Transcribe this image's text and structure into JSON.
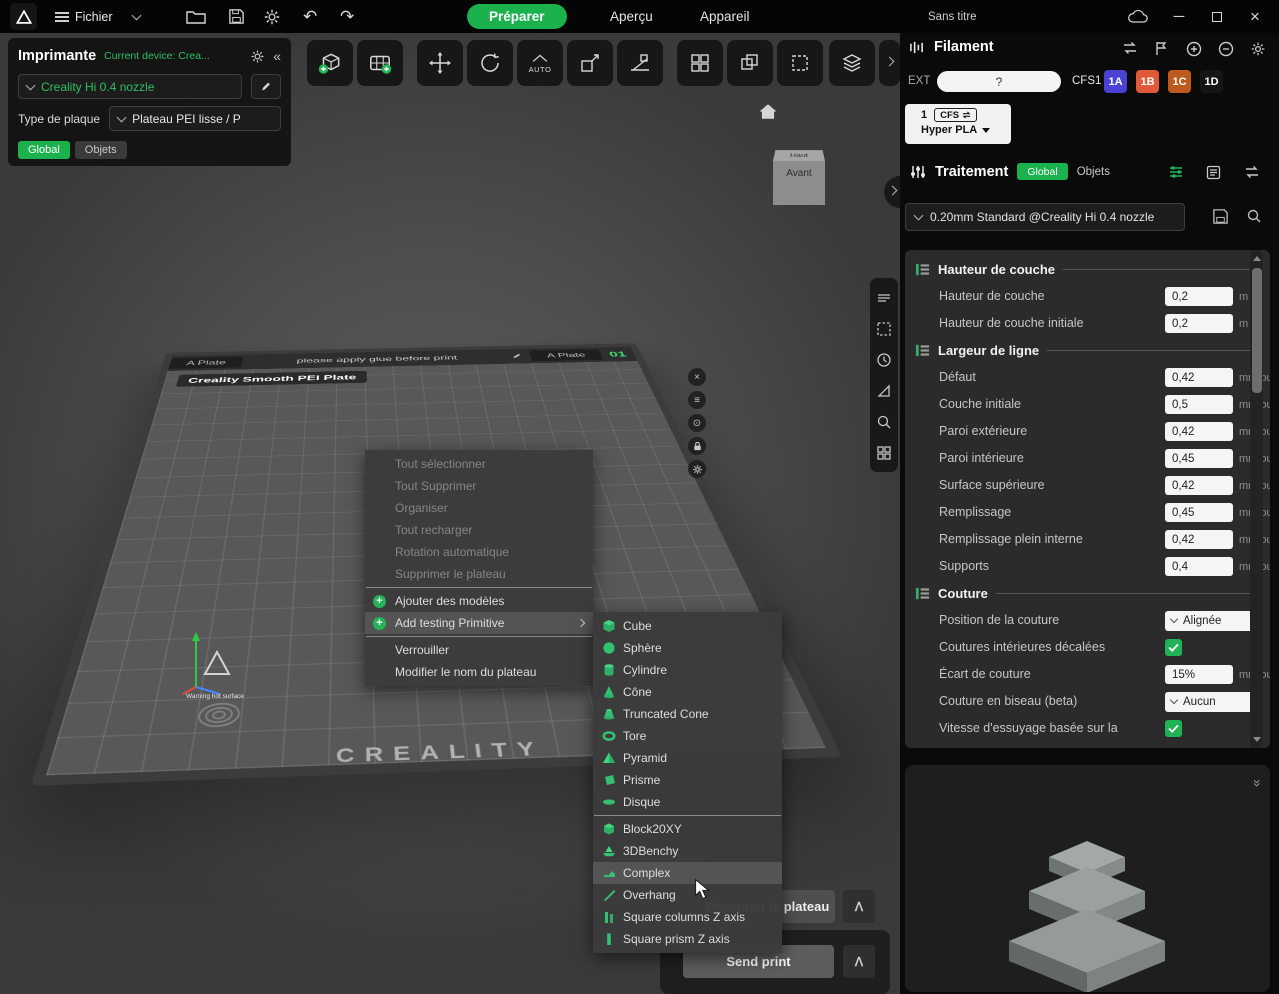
{
  "accent": "#1bb24e",
  "topbar": {
    "menu": "Fichier",
    "doc_title": "Sans titre",
    "tabs": [
      {
        "label": "Préparer"
      },
      {
        "label": "Aperçu"
      },
      {
        "label": "Appareil"
      }
    ]
  },
  "toolbar": {
    "auto_label": "AUTO"
  },
  "printer": {
    "title": "Imprimante",
    "current_device": "Current device: Crea...",
    "name": "Creality Hi 0.4 nozzle",
    "plate_type_label": "Type de plaque",
    "plate_type": "Plateau PEI lisse / P",
    "tab_global": "Global",
    "tab_objects": "Objets"
  },
  "viewport": {
    "plate_tab_left": "A Plate",
    "plate_tab_right": "A Plate",
    "plate_hint": "please apply glue before print",
    "plate_number": "01",
    "plate_name": "Creality Smooth PEI Plate",
    "brand": "CREALITY",
    "warning": "Warning hot surface",
    "view_cube": {
      "top": "Haut",
      "front": "Avant"
    }
  },
  "context_menu": {
    "items": [
      {
        "label": "Tout sélectionner",
        "disabled": true
      },
      {
        "label": "Tout Supprimer",
        "disabled": true
      },
      {
        "label": "Organiser",
        "disabled": true
      },
      {
        "label": "Tout recharger",
        "disabled": true
      },
      {
        "label": "Rotation automatique",
        "disabled": true
      },
      {
        "label": "Supprimer le plateau",
        "disabled": true
      },
      {
        "label": "Ajouter des modèles",
        "disabled": false
      },
      {
        "label": "Add testing Primitive",
        "disabled": false
      },
      {
        "label": "Verrouiller",
        "disabled": false
      },
      {
        "label": "Modifier le nom du plateau",
        "disabled": false
      }
    ]
  },
  "submenu": {
    "primitives": [
      "Cube",
      "Sphère",
      "Cylindre",
      "Cône",
      "Truncated Cone",
      "Tore",
      "Pyramid",
      "Prisme",
      "Disque"
    ],
    "models": [
      "Block20XY",
      "3DBenchy",
      "Complex",
      "Overhang",
      "Square columns Z axis",
      "Square prism Z axis"
    ],
    "highlighted": "Complex"
  },
  "filament": {
    "title": "Filament",
    "ext_label": "EXT",
    "ext_value": "?",
    "cfs_label": "CFS1",
    "slots": [
      {
        "label": "1A",
        "color": "#4a42d2"
      },
      {
        "label": "1B",
        "color": "#e05a3a"
      },
      {
        "label": "1C",
        "color": "#bf5a1e"
      },
      {
        "label": "1D",
        "color": "#151515"
      }
    ],
    "tray_index": "1",
    "tray_type": "CFS",
    "material": "Hyper PLA"
  },
  "process": {
    "title": "Traitement",
    "tab_global": "Global",
    "tab_objects": "Objets",
    "preset": "0.20mm Standard @Creality Hi 0.4 nozzle",
    "sections": [
      {
        "title": "Hauteur de couche",
        "rows": [
          {
            "label": "Hauteur de couche",
            "value": "0,2",
            "unit": "m"
          },
          {
            "label": "Hauteur de couche initiale",
            "value": "0,2",
            "unit": "m"
          }
        ]
      },
      {
        "title": "Largeur de ligne",
        "rows": [
          {
            "label": "Défaut",
            "value": "0,42",
            "unit": "mm ou"
          },
          {
            "label": "Couche initiale",
            "value": "0,5",
            "unit": "mm ou"
          },
          {
            "label": "Paroi extérieure",
            "value": "0,42",
            "unit": "mm ou"
          },
          {
            "label": "Paroi intérieure",
            "value": "0,45",
            "unit": "mm ou"
          },
          {
            "label": "Surface supérieure",
            "value": "0,42",
            "unit": "mm ou"
          },
          {
            "label": "Remplissage",
            "value": "0,45",
            "unit": "mm ou"
          },
          {
            "label": "Remplissage plein interne",
            "value": "0,42",
            "unit": "mm ou"
          },
          {
            "label": "Supports",
            "value": "0,4",
            "unit": "mm ou"
          }
        ]
      },
      {
        "title": "Couture",
        "rows": [
          {
            "label": "Position de la couture",
            "value": "Alignée"
          },
          {
            "label": "Coutures intérieures décalées",
            "checked": true
          },
          {
            "label": "Écart de couture",
            "value": "15%",
            "unit": "mm ou"
          },
          {
            "label": "Couture en biseau (beta)",
            "value": "Aucun"
          },
          {
            "label": "Vitesse d'essuyage basée sur la",
            "checked": true
          }
        ]
      }
    ]
  },
  "actions": {
    "slice": "Découper le plateau",
    "send": "Send print"
  }
}
